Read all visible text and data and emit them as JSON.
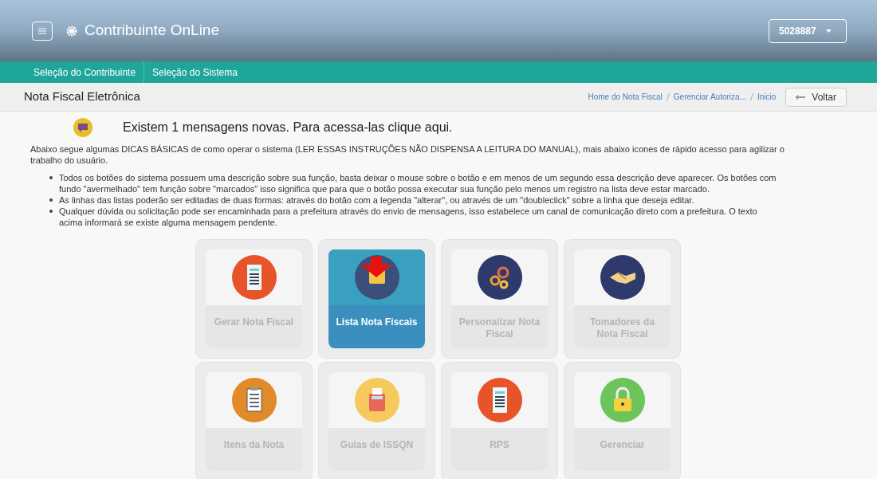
{
  "header": {
    "title": "Contribuinte OnLine",
    "user": "5028887"
  },
  "nav": [
    "Seleção do Contribuinte",
    "Seleção do Sistema"
  ],
  "page_title": "Nota Fiscal Eletrônica",
  "breadcrumbs": [
    "Home do Nota Fiscal",
    "Gerenciar Autoriza...",
    "Inicio"
  ],
  "back_button": "Voltar",
  "message": "Existem 1 mensagens novas. Para acessa-las clique aqui.",
  "intro": "Abaixo segue algumas DICAS BÁSICAS de como operar o sistema (LER ESSAS INSTRUÇÕES NÃO DISPENSA A LEITURA DO MANUAL), mais abaixo icones de rápido acesso para agilizar o trabalho do usuário.",
  "tips": [
    "Todos os botões do sistema possuem uma descrição sobre sua função, basta deixar o mouse sobre o botão e em menos de um segundo essa descrição deve aparecer. Os botões com fundo \"avermelhado\" tem função sobre \"marcados\" isso significa que para que o botão possa executar sua função pelo menos um registro na lista deve estar marcado.",
    "As linhas das listas poderão ser editadas de duas formas: através do botão com a legenda \"alterar\", ou através de um \"doubleclick\" sobre a linha que deseja editar.",
    "Qualquer dúvida ou solicitação pode ser encaminhada para a prefeitura através do envio de mensagens, isso estabelece um canal de comunicação direto com a prefeitura. O texto acima informará se existe alguma mensagem pendente."
  ],
  "tiles": [
    {
      "label": "Gerar Nota Fiscal",
      "selected": false
    },
    {
      "label": "Lista Nota Fiscais",
      "selected": true
    },
    {
      "label": "Personalizar Nota Fiscal",
      "selected": false
    },
    {
      "label": "Tomadores da Nota Fiscal",
      "selected": false
    },
    {
      "label": "Itens da Nota",
      "selected": false
    },
    {
      "label": "Guias de ISSQN",
      "selected": false
    },
    {
      "label": "RPS",
      "selected": false
    },
    {
      "label": "Gerenciar",
      "selected": false
    }
  ]
}
